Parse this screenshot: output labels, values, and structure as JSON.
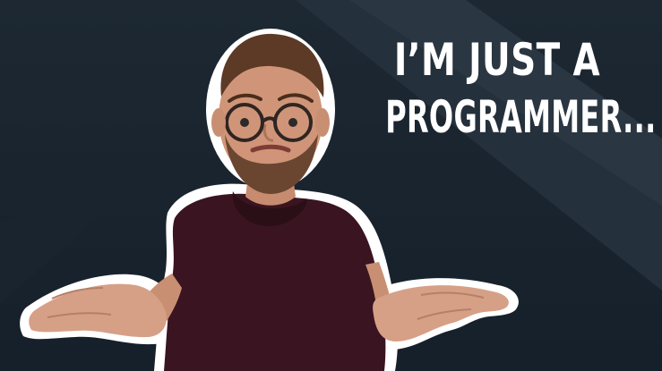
{
  "thumbnail": {
    "headline_line1": "I’M JUST A",
    "headline_line2": "PROGRAMMER...",
    "colors": {
      "background": "#1d2832",
      "background_light_band": "#2a3641",
      "text": "#ffffff",
      "shirt": "#3a1420",
      "skin": "#c98f73",
      "outline": "#ffffff"
    }
  }
}
